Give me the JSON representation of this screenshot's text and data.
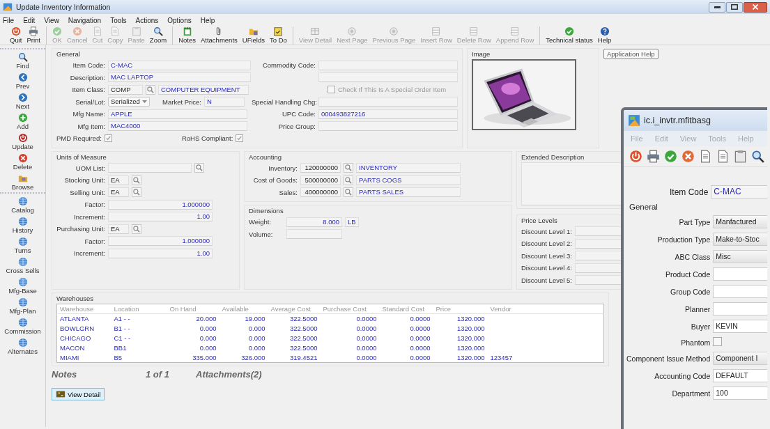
{
  "window": {
    "title": "Update Inventory Information"
  },
  "menu": [
    "File",
    "Edit",
    "View",
    "Navigation",
    "Tools",
    "Actions",
    "Options",
    "Help"
  ],
  "toolbar": {
    "groups": [
      [
        {
          "label": "Quit",
          "disabled": false
        },
        {
          "label": "Print",
          "disabled": false
        }
      ],
      [
        {
          "label": "OK",
          "disabled": true
        },
        {
          "label": "Cancel",
          "disabled": true
        },
        {
          "label": "Cut",
          "disabled": true
        },
        {
          "label": "Copy",
          "disabled": true
        },
        {
          "label": "Paste",
          "disabled": true
        },
        {
          "label": "Zoom",
          "disabled": false
        }
      ],
      [
        {
          "label": "Notes",
          "disabled": false
        },
        {
          "label": "Attachments",
          "disabled": false
        },
        {
          "label": "UFields",
          "disabled": false
        },
        {
          "label": "To Do",
          "disabled": false
        }
      ],
      [
        {
          "label": "View Detail",
          "disabled": true
        },
        {
          "label": "Next Page",
          "disabled": true
        },
        {
          "label": "Previous Page",
          "disabled": true
        },
        {
          "label": "Insert Row",
          "disabled": true
        },
        {
          "label": "Delete Row",
          "disabled": true
        },
        {
          "label": "Append Row",
          "disabled": true
        }
      ],
      [
        {
          "label": "Technical status",
          "disabled": false
        },
        {
          "label": "Help",
          "disabled": false
        }
      ]
    ],
    "tooltip": "Application Help"
  },
  "sidebar": {
    "groups": [
      [
        "Find",
        "Prev",
        "Next",
        "Add",
        "Update",
        "Delete",
        "Browse"
      ],
      [
        "Catalog",
        "History",
        "Turns",
        "Cross Sells",
        "Mfg-Base",
        "Mfg-Plan",
        "Commission",
        "Alternates"
      ]
    ]
  },
  "general": {
    "title": "General",
    "item_code": {
      "label": "Item Code:",
      "value": "C-MAC"
    },
    "description": {
      "label": "Description:",
      "value": "MAC LAPTOP"
    },
    "item_class": {
      "label": "Item Class:",
      "value": "COMP",
      "description": "COMPUTER EQUIPMENT"
    },
    "serial_lot": {
      "label": "Serial/Lot:",
      "value": "Serialized"
    },
    "market_price": {
      "label": "Market Price:",
      "value": "N"
    },
    "mfg_name": {
      "label": "Mfg Name:",
      "value": "APPLE"
    },
    "mfg_item": {
      "label": "Mfg Item:",
      "value": "MAC4000"
    },
    "pmd_required": {
      "label": "PMD Required:",
      "checked": true
    },
    "rohs_compliant": {
      "label": "RoHS Compliant:",
      "checked": true
    },
    "commodity_code": {
      "label": "Commodity Code:"
    },
    "special_order": {
      "label": "Check If This Is A Special Order Item",
      "checked": false
    },
    "special_handling": {
      "label": "Special Handling Chg:"
    },
    "upc_code": {
      "label": "UPC Code:",
      "value": "000493827216"
    },
    "price_group": {
      "label": "Price Group:"
    }
  },
  "image": {
    "title": "Image"
  },
  "units": {
    "title": "Units of Measure",
    "rows": [
      {
        "kind": "list",
        "label": "UOM List:"
      },
      {
        "kind": "unit",
        "label": "Stocking Unit:",
        "value": "EA"
      },
      {
        "kind": "unit",
        "label": "Selling Unit:",
        "value": "EA"
      },
      {
        "kind": "number",
        "label": "Factor:",
        "value": "1.000000"
      },
      {
        "kind": "number",
        "label": "Increment:",
        "value": "1.00"
      },
      {
        "kind": "unit",
        "label": "Purchasing Unit:",
        "value": "EA"
      },
      {
        "kind": "number",
        "label": "Factor:",
        "value": "1.000000"
      },
      {
        "kind": "number",
        "label": "Increment:",
        "value": "1.00"
      }
    ]
  },
  "accounting": {
    "title": "Accounting",
    "rows": [
      {
        "label": "Inventory:",
        "account": "120000000",
        "name": "INVENTORY"
      },
      {
        "label": "Cost of Goods:",
        "account": "500000000",
        "name": "PARTS COGS"
      },
      {
        "label": "Sales:",
        "account": "400000000",
        "name": "PARTS SALES"
      }
    ]
  },
  "dimensions": {
    "title": "Dimensions",
    "weight": {
      "label": "Weight:",
      "value": "8.000",
      "unit": "LB"
    },
    "volume": {
      "label": "Volume:"
    }
  },
  "extended_description": {
    "title": "Extended Description"
  },
  "price_levels": {
    "title": "Price Levels",
    "levels": [
      "Discount Level 1:",
      "Discount Level 2:",
      "Discount Level 3:",
      "Discount Level 4:",
      "Discount Level 5:"
    ]
  },
  "warehouses": {
    "title": "Warehouses",
    "columns": [
      "Warehouse",
      "Location",
      "On Hand",
      "Available",
      "Average Cost",
      "Purchase Cost",
      "Standard Cost",
      "Price",
      "Vendor"
    ],
    "rows": [
      [
        "ATLANTA",
        "A1  -  -",
        "20.000",
        "19.000",
        "322.5000",
        "0.0000",
        "0.0000",
        "1320.000"
      ],
      [
        "BOWLGRN",
        "B1  -  -",
        "0.000",
        "0.000",
        "322.5000",
        "0.0000",
        "0.0000",
        "1320.000"
      ],
      [
        "CHICAGO",
        "C1  -  -",
        "0.000",
        "0.000",
        "322.5000",
        "0.0000",
        "0.0000",
        "1320.000"
      ],
      [
        "MACON",
        "BB1",
        "0.000",
        "0.000",
        "322.5000",
        "0.0000",
        "0.0000",
        "1320.000"
      ],
      [
        "MIAMI",
        "B5",
        "335.000",
        "326.000",
        "319.4521",
        "0.0000",
        "0.0000",
        "1320.000",
        "123457"
      ]
    ]
  },
  "notes": {
    "label": "Notes",
    "page": "1 of 1",
    "attachments": "Attachments(2)",
    "button": "View Detail"
  },
  "popup": {
    "title": "ic.i_invtr.mfitbasg",
    "menu": [
      {
        "label": "File",
        "disabled": true
      },
      {
        "label": "Edit",
        "disabled": true
      },
      {
        "label": "View",
        "disabled": true
      },
      {
        "label": "Tools",
        "disabled": true
      },
      {
        "label": "Help",
        "disabled": true
      }
    ],
    "item_code": {
      "label": "Item Code",
      "value": "C-MAC"
    },
    "section": "General",
    "fields": [
      {
        "kind": "dropdown",
        "label": "Part Type",
        "value": "Manfactured"
      },
      {
        "kind": "dropdown",
        "label": "Production Type",
        "value": "Make-to-Stoc"
      },
      {
        "kind": "dropdown",
        "label": "ABC Class",
        "value": "Misc"
      },
      {
        "kind": "text",
        "label": "Product Code"
      },
      {
        "kind": "text",
        "label": "Group Code"
      },
      {
        "kind": "text",
        "label": "Planner"
      },
      {
        "kind": "text",
        "label": "Buyer",
        "value": "KEVIN"
      },
      {
        "kind": "checkbox",
        "label": "Phantom",
        "checked": false
      },
      {
        "kind": "dropdown",
        "label": "Component Issue Method",
        "value": "Component I"
      },
      {
        "kind": "text",
        "label": "Accounting Code",
        "value": "DEFAULT"
      },
      {
        "kind": "text",
        "label": "Department",
        "value": "100"
      }
    ]
  }
}
